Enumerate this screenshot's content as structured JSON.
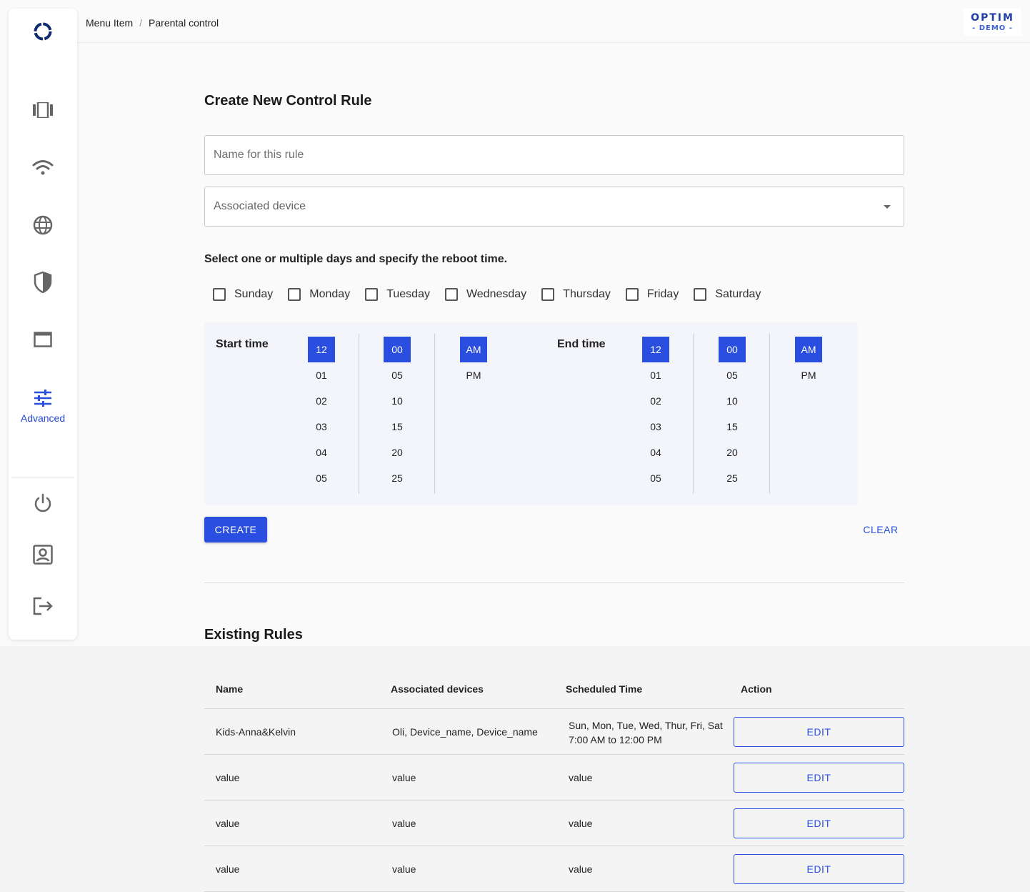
{
  "header": {
    "breadcrumb": [
      "Menu Item",
      "Parental control"
    ],
    "breadcrumb_sep": "/",
    "logo": {
      "main": "OPTIM",
      "sub": "- DEMO -"
    }
  },
  "sidebar": {
    "items": [
      {
        "icon": "logo-ring-icon",
        "label": ""
      },
      {
        "icon": "dashboard-icon",
        "label": ""
      },
      {
        "icon": "wifi-icon",
        "label": ""
      },
      {
        "icon": "globe-icon",
        "label": ""
      },
      {
        "icon": "shield-icon",
        "label": ""
      },
      {
        "icon": "window-icon",
        "label": ""
      },
      {
        "icon": "sliders-icon",
        "label": "Advanced",
        "active": true
      },
      {
        "icon": "power-icon",
        "label": ""
      },
      {
        "icon": "account-icon",
        "label": ""
      },
      {
        "icon": "logout-icon",
        "label": ""
      }
    ]
  },
  "form": {
    "title": "Create New Control Rule",
    "name_placeholder": "Name for this rule",
    "device_placeholder": "Associated device",
    "hint": "Select one or multiple days and specify the reboot time.",
    "days": [
      "Sunday",
      "Monday",
      "Tuesday",
      "Wednesday",
      "Thursday",
      "Friday",
      "Saturday"
    ],
    "start_label": "Start time",
    "end_label": "End time",
    "hours": [
      "12",
      "01",
      "02",
      "03",
      "04",
      "05"
    ],
    "minutes": [
      "00",
      "05",
      "10",
      "15",
      "20",
      "25"
    ],
    "ampm": [
      "AM",
      "PM"
    ],
    "start_selected": {
      "hour": "12",
      "minute": "00",
      "ampm": "AM"
    },
    "end_selected": {
      "hour": "12",
      "minute": "00",
      "ampm": "AM"
    },
    "create_label": "CREATE",
    "clear_label": "CLEAR"
  },
  "rules": {
    "title": "Existing Rules",
    "columns": [
      "Name",
      "Associated devices",
      "Scheduled Time",
      "Action"
    ],
    "rows": [
      {
        "name": "Kids-Anna&Kelvin",
        "devices": "Oli, Device_name, Device_name",
        "time": [
          "Sun, Mon, Tue, Wed, Thur, Fri, Sat",
          "7:00 AM to 12:00 PM"
        ],
        "action": "EDIT"
      },
      {
        "name": "value",
        "devices": "value",
        "time": [
          "value"
        ],
        "action": "EDIT"
      },
      {
        "name": "value",
        "devices": "value",
        "time": [
          "value"
        ],
        "action": "EDIT"
      },
      {
        "name": "value",
        "devices": "value",
        "time": [
          "value"
        ],
        "action": "EDIT"
      }
    ]
  },
  "colors": {
    "accent": "#2a4fe0",
    "logo": "#1e3ea6",
    "panel": "#f3f5fa"
  }
}
